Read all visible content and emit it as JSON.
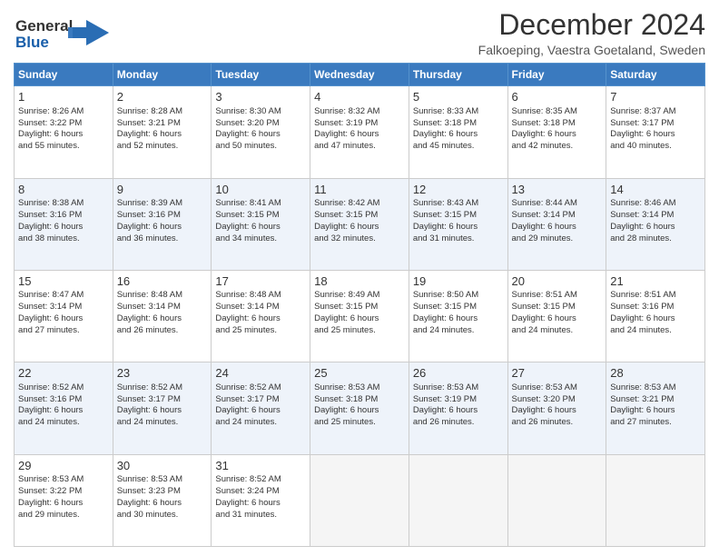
{
  "header": {
    "logo_line1": "General",
    "logo_line2": "Blue",
    "title": "December 2024",
    "subtitle": "Falkoeping, Vaestra Goetaland, Sweden"
  },
  "days_of_week": [
    "Sunday",
    "Monday",
    "Tuesday",
    "Wednesday",
    "Thursday",
    "Friday",
    "Saturday"
  ],
  "weeks": [
    [
      {
        "day": 1,
        "lines": [
          "Sunrise: 8:26 AM",
          "Sunset: 3:22 PM",
          "Daylight: 6 hours",
          "and 55 minutes."
        ]
      },
      {
        "day": 2,
        "lines": [
          "Sunrise: 8:28 AM",
          "Sunset: 3:21 PM",
          "Daylight: 6 hours",
          "and 52 minutes."
        ]
      },
      {
        "day": 3,
        "lines": [
          "Sunrise: 8:30 AM",
          "Sunset: 3:20 PM",
          "Daylight: 6 hours",
          "and 50 minutes."
        ]
      },
      {
        "day": 4,
        "lines": [
          "Sunrise: 8:32 AM",
          "Sunset: 3:19 PM",
          "Daylight: 6 hours",
          "and 47 minutes."
        ]
      },
      {
        "day": 5,
        "lines": [
          "Sunrise: 8:33 AM",
          "Sunset: 3:18 PM",
          "Daylight: 6 hours",
          "and 45 minutes."
        ]
      },
      {
        "day": 6,
        "lines": [
          "Sunrise: 8:35 AM",
          "Sunset: 3:18 PM",
          "Daylight: 6 hours",
          "and 42 minutes."
        ]
      },
      {
        "day": 7,
        "lines": [
          "Sunrise: 8:37 AM",
          "Sunset: 3:17 PM",
          "Daylight: 6 hours",
          "and 40 minutes."
        ]
      }
    ],
    [
      {
        "day": 8,
        "lines": [
          "Sunrise: 8:38 AM",
          "Sunset: 3:16 PM",
          "Daylight: 6 hours",
          "and 38 minutes."
        ]
      },
      {
        "day": 9,
        "lines": [
          "Sunrise: 8:39 AM",
          "Sunset: 3:16 PM",
          "Daylight: 6 hours",
          "and 36 minutes."
        ]
      },
      {
        "day": 10,
        "lines": [
          "Sunrise: 8:41 AM",
          "Sunset: 3:15 PM",
          "Daylight: 6 hours",
          "and 34 minutes."
        ]
      },
      {
        "day": 11,
        "lines": [
          "Sunrise: 8:42 AM",
          "Sunset: 3:15 PM",
          "Daylight: 6 hours",
          "and 32 minutes."
        ]
      },
      {
        "day": 12,
        "lines": [
          "Sunrise: 8:43 AM",
          "Sunset: 3:15 PM",
          "Daylight: 6 hours",
          "and 31 minutes."
        ]
      },
      {
        "day": 13,
        "lines": [
          "Sunrise: 8:44 AM",
          "Sunset: 3:14 PM",
          "Daylight: 6 hours",
          "and 29 minutes."
        ]
      },
      {
        "day": 14,
        "lines": [
          "Sunrise: 8:46 AM",
          "Sunset: 3:14 PM",
          "Daylight: 6 hours",
          "and 28 minutes."
        ]
      }
    ],
    [
      {
        "day": 15,
        "lines": [
          "Sunrise: 8:47 AM",
          "Sunset: 3:14 PM",
          "Daylight: 6 hours",
          "and 27 minutes."
        ]
      },
      {
        "day": 16,
        "lines": [
          "Sunrise: 8:48 AM",
          "Sunset: 3:14 PM",
          "Daylight: 6 hours",
          "and 26 minutes."
        ]
      },
      {
        "day": 17,
        "lines": [
          "Sunrise: 8:48 AM",
          "Sunset: 3:14 PM",
          "Daylight: 6 hours",
          "and 25 minutes."
        ]
      },
      {
        "day": 18,
        "lines": [
          "Sunrise: 8:49 AM",
          "Sunset: 3:15 PM",
          "Daylight: 6 hours",
          "and 25 minutes."
        ]
      },
      {
        "day": 19,
        "lines": [
          "Sunrise: 8:50 AM",
          "Sunset: 3:15 PM",
          "Daylight: 6 hours",
          "and 24 minutes."
        ]
      },
      {
        "day": 20,
        "lines": [
          "Sunrise: 8:51 AM",
          "Sunset: 3:15 PM",
          "Daylight: 6 hours",
          "and 24 minutes."
        ]
      },
      {
        "day": 21,
        "lines": [
          "Sunrise: 8:51 AM",
          "Sunset: 3:16 PM",
          "Daylight: 6 hours",
          "and 24 minutes."
        ]
      }
    ],
    [
      {
        "day": 22,
        "lines": [
          "Sunrise: 8:52 AM",
          "Sunset: 3:16 PM",
          "Daylight: 6 hours",
          "and 24 minutes."
        ]
      },
      {
        "day": 23,
        "lines": [
          "Sunrise: 8:52 AM",
          "Sunset: 3:17 PM",
          "Daylight: 6 hours",
          "and 24 minutes."
        ]
      },
      {
        "day": 24,
        "lines": [
          "Sunrise: 8:52 AM",
          "Sunset: 3:17 PM",
          "Daylight: 6 hours",
          "and 24 minutes."
        ]
      },
      {
        "day": 25,
        "lines": [
          "Sunrise: 8:53 AM",
          "Sunset: 3:18 PM",
          "Daylight: 6 hours",
          "and 25 minutes."
        ]
      },
      {
        "day": 26,
        "lines": [
          "Sunrise: 8:53 AM",
          "Sunset: 3:19 PM",
          "Daylight: 6 hours",
          "and 26 minutes."
        ]
      },
      {
        "day": 27,
        "lines": [
          "Sunrise: 8:53 AM",
          "Sunset: 3:20 PM",
          "Daylight: 6 hours",
          "and 26 minutes."
        ]
      },
      {
        "day": 28,
        "lines": [
          "Sunrise: 8:53 AM",
          "Sunset: 3:21 PM",
          "Daylight: 6 hours",
          "and 27 minutes."
        ]
      }
    ],
    [
      {
        "day": 29,
        "lines": [
          "Sunrise: 8:53 AM",
          "Sunset: 3:22 PM",
          "Daylight: 6 hours",
          "and 29 minutes."
        ]
      },
      {
        "day": 30,
        "lines": [
          "Sunrise: 8:53 AM",
          "Sunset: 3:23 PM",
          "Daylight: 6 hours",
          "and 30 minutes."
        ]
      },
      {
        "day": 31,
        "lines": [
          "Sunrise: 8:52 AM",
          "Sunset: 3:24 PM",
          "Daylight: 6 hours",
          "and 31 minutes."
        ]
      },
      null,
      null,
      null,
      null
    ]
  ]
}
